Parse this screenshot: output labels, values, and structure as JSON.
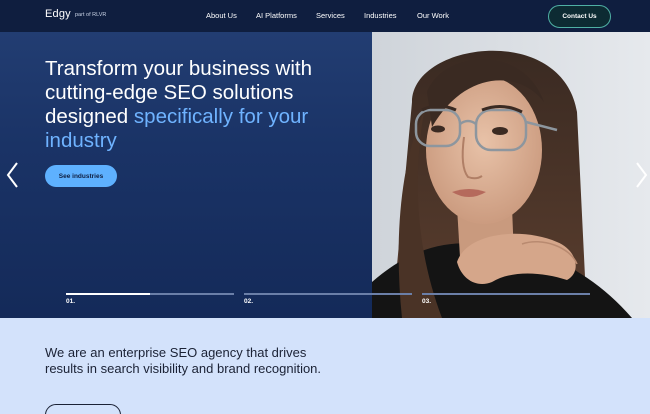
{
  "nav": {
    "logo": "Edgy",
    "part_of": "part of RLVR",
    "items": [
      {
        "label": "About Us"
      },
      {
        "label": "AI Platforms"
      },
      {
        "label": "Services"
      },
      {
        "label": "Industries"
      },
      {
        "label": "Our Work"
      }
    ],
    "contact_label": "Contact Us"
  },
  "hero": {
    "headline_white": "Transform your business with cutting-edge SEO solutions designed ",
    "headline_highlight": "specifically for your industry",
    "cta_label": "See industries",
    "slides": [
      {
        "label": "01.",
        "progress": 0.5
      },
      {
        "label": "02.",
        "progress": 0
      },
      {
        "label": "03.",
        "progress": 0
      }
    ],
    "image_alt": "Woman with glasses resting chin on hand"
  },
  "intro": {
    "text": "We are an enterprise SEO agency that drives results in search visibility and brand recognition."
  },
  "colors": {
    "nav_bg": "#0f1e3f",
    "accent": "#5eb1ff",
    "highlight": "#6fb3ff",
    "section_bg": "#d3e2fb"
  }
}
